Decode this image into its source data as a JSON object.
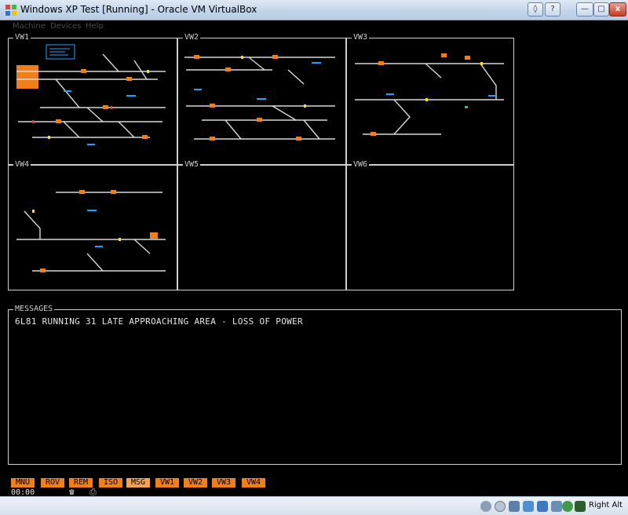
{
  "window": {
    "title": "Windows XP Test [Running] - Oracle VM VirtualBox",
    "buttons": {
      "restore": "◊",
      "help": "?",
      "minimize": "—",
      "maximize": "□",
      "close": "x"
    }
  },
  "menubar": {
    "items": [
      "Machine",
      "Devices",
      "Help"
    ]
  },
  "views": [
    {
      "label": "VW1"
    },
    {
      "label": "VW2"
    },
    {
      "label": "VW3"
    },
    {
      "label": "VW4"
    },
    {
      "label": "VW5"
    },
    {
      "label": "VW6"
    }
  ],
  "messages": {
    "label": "MESSAGES",
    "lines": [
      "6L81 RUNNING 31 LATE APPROACHING AREA - LOSS OF POWER"
    ]
  },
  "function_keys": [
    "MNU",
    "ROV",
    "REM",
    "ISO",
    "MSG",
    "VW1",
    "VW2",
    "VW3",
    "VW4"
  ],
  "active_function_key": "MSG",
  "clock": "00:00",
  "statusbar": {
    "host_key": "Right Alt",
    "icons": [
      "hard-disk-icon",
      "optical-drive-icon",
      "pencil-icon",
      "network-icon",
      "folder-icon",
      "display-icon",
      "capture-icon",
      "host-key-arrow-icon"
    ]
  },
  "colors": {
    "panel_border": "#cfcfcf",
    "function_key": "#f07f18",
    "function_key_active": "#f7a24e",
    "track": "#d8d8d8",
    "signal_orange": "#f07f18",
    "signal_cyan": "#1aa3ff",
    "signal_yellow": "#ffe000",
    "signal_red": "#ff3030",
    "signal_green": "#20d040"
  }
}
